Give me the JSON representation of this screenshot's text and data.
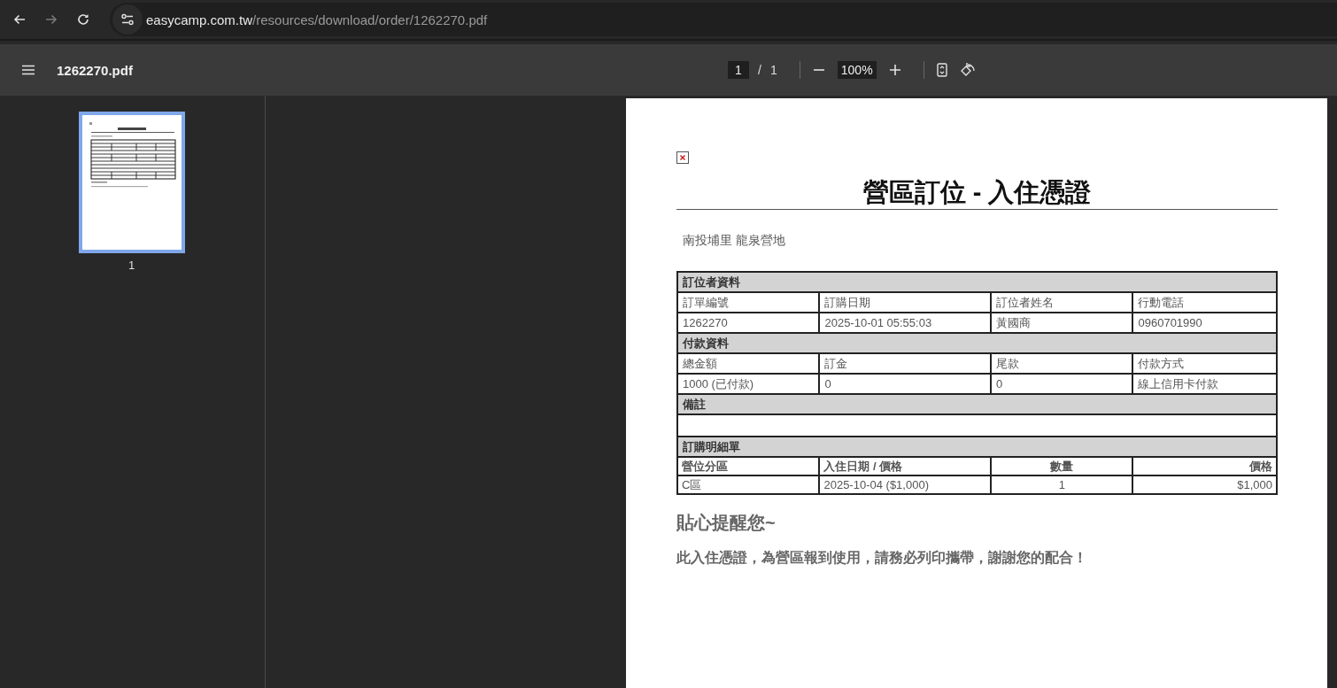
{
  "browser": {
    "url_host": "easycamp.com.tw",
    "url_path": "/resources/download/order/1262270.pdf"
  },
  "viewer": {
    "file_name": "1262270.pdf",
    "page_input": "1",
    "page_separator": "/",
    "page_total": "1",
    "zoom": "100%"
  },
  "thumbnails": [
    {
      "label": "1",
      "selected": true
    }
  ],
  "document": {
    "title": "營區訂位 - 入住憑證",
    "subtitle": "南投埔里 龍泉營地",
    "sections": [
      {
        "kind": "grid",
        "heading": "訂位者資料",
        "columns": [
          "訂單編號",
          "訂購日期",
          "訂位者姓名",
          "行動電話"
        ],
        "rows": [
          [
            "1262270",
            "2025-10-01 05:55:03",
            "黃國商",
            "0960701990"
          ]
        ]
      },
      {
        "kind": "grid",
        "heading": "付款資料",
        "columns": [
          "總金額",
          "訂金",
          "尾款",
          "付款方式"
        ],
        "rows": [
          [
            "1000 (已付款)",
            "0",
            "0",
            "線上信用卡付款"
          ]
        ]
      },
      {
        "kind": "note",
        "heading": "備註"
      },
      {
        "kind": "detail",
        "heading": "訂購明細單",
        "columns": [
          "營位分區",
          "入住日期 / 價格",
          "數量",
          "價格"
        ],
        "rows": [
          [
            "C區",
            "2025-10-04 ($1,000)",
            "1",
            "$1,000"
          ]
        ]
      }
    ],
    "reminder_heading": "貼心提醒您~",
    "reminder_text": "此入住憑證，為營區報到使用，請務必列印攜帶，謝謝您的配合！"
  }
}
